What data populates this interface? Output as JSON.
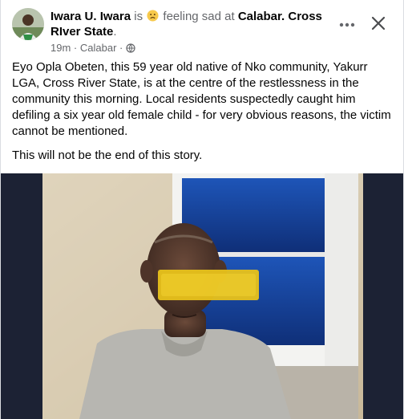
{
  "post": {
    "author": "Iwara U. Iwara",
    "is_text": "is",
    "feeling_text": "feeling sad at",
    "location": "Calabar. Cross RIver State",
    "location_suffix": ".",
    "time": "19m",
    "dot": "·",
    "place": "Calabar",
    "dot2": "·",
    "paragraph1": "Eyo Opla Obeten, this 59 year old native of Nko community, Yakurr LGA, Cross River State, is at the centre of the restlessness in the community this morning. Local residents suspectedly caught him defiling a six year old female child - for very obvious reasons, the victim cannot be mentioned.",
    "paragraph2": "This will not be the end of this story."
  },
  "icons": {
    "feeling": "sad-face-emoji",
    "audience": "globe-icon",
    "more": "more-options-icon",
    "close": "close-icon"
  },
  "colors": {
    "text": "#050505",
    "muted": "#65676b",
    "photo_frame": "#1c2234",
    "censor_bar": "#e8c21a"
  }
}
